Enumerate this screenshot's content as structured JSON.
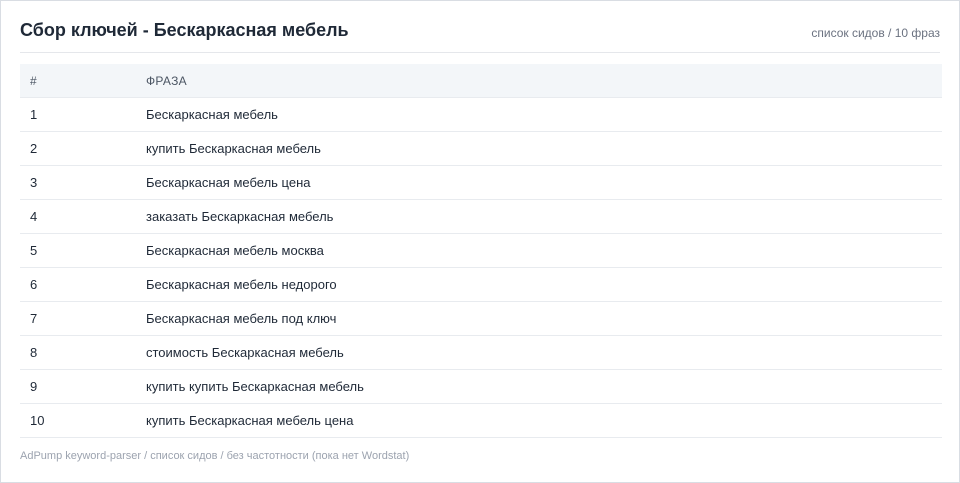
{
  "header": {
    "title": "Сбор ключей - Бескаркасная мебель",
    "subtitle": "список сидов / 10 фраз"
  },
  "table": {
    "columns": [
      "#",
      "ФРАЗА"
    ],
    "rows": [
      {
        "num": "1",
        "phrase": "Бескаркасная мебель"
      },
      {
        "num": "2",
        "phrase": "купить Бескаркасная мебель"
      },
      {
        "num": "3",
        "phrase": "Бескаркасная мебель цена"
      },
      {
        "num": "4",
        "phrase": "заказать Бескаркасная мебель"
      },
      {
        "num": "5",
        "phrase": "Бескаркасная мебель москва"
      },
      {
        "num": "6",
        "phrase": "Бескаркасная мебель недорого"
      },
      {
        "num": "7",
        "phrase": "Бескаркасная мебель под ключ"
      },
      {
        "num": "8",
        "phrase": "стоимость Бескаркасная мебель"
      },
      {
        "num": "9",
        "phrase": "купить купить Бескаркасная мебель"
      },
      {
        "num": "10",
        "phrase": "купить Бескаркасная мебель цена"
      }
    ]
  },
  "footer": {
    "text": "AdPump keyword-parser / список сидов / без частотности (пока нет Wordstat)"
  }
}
